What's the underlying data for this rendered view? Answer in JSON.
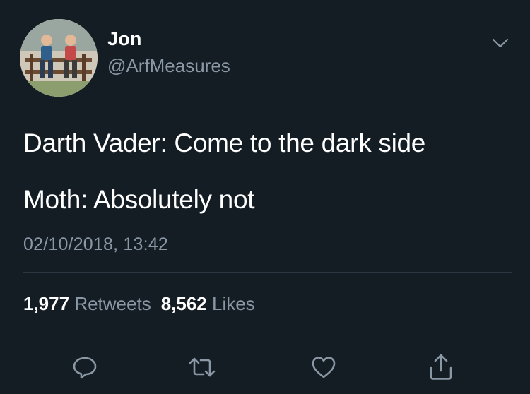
{
  "user": {
    "display_name": "Jon",
    "handle": "@ArfMeasures"
  },
  "tweet": {
    "lines": [
      "Darth Vader: Come to the dark side",
      "Moth: Absolutely not"
    ],
    "timestamp": "02/10/2018, 13:42"
  },
  "stats": {
    "retweets_count": "1,977",
    "retweets_label": "Retweets",
    "likes_count": "8,562",
    "likes_label": "Likes"
  },
  "actions": {
    "reply_icon": "reply-icon",
    "retweet_icon": "retweet-icon",
    "like_icon": "heart-icon",
    "share_icon": "share-icon"
  },
  "colors": {
    "background": "#141c24",
    "text": "#ffffff",
    "secondary_text": "#8a97a4",
    "divider": "#2b3640"
  }
}
